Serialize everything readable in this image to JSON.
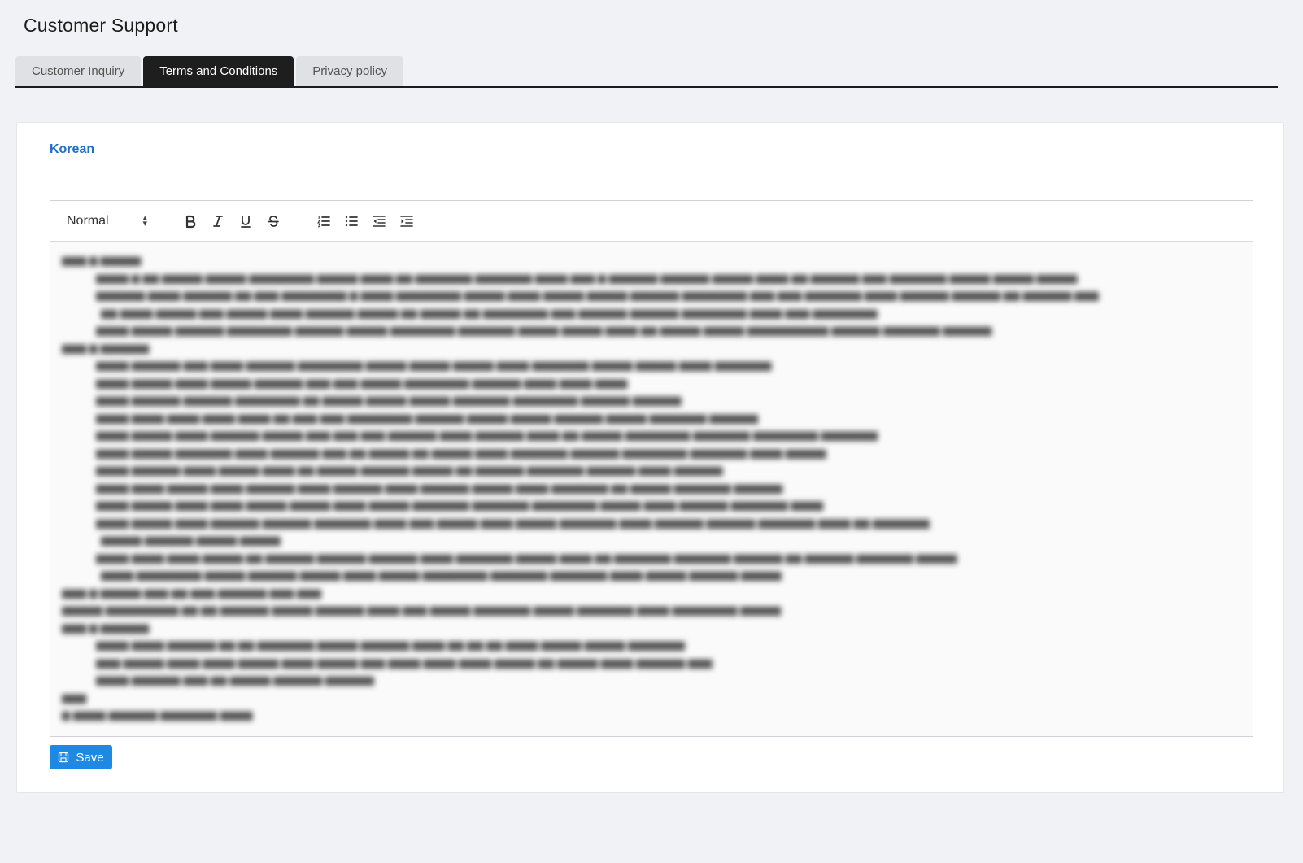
{
  "page": {
    "title": "Customer Support"
  },
  "tabs": [
    {
      "label": "Customer Inquiry",
      "active": false
    },
    {
      "label": "Terms and Conditions",
      "active": true
    },
    {
      "label": "Privacy policy",
      "active": false
    }
  ],
  "card": {
    "language_label": "Korean"
  },
  "editor": {
    "format_value": "Normal",
    "toolbar_icons": [
      "bold-icon",
      "italic-icon",
      "underline-icon",
      "strikethrough-icon",
      "ordered-list-icon",
      "bullet-list-icon",
      "outdent-icon",
      "indent-icon"
    ]
  },
  "actions": {
    "save_label": "Save"
  },
  "colors": {
    "accent": "#1e88e5",
    "link": "#1f6fc6",
    "active_tab": "#1e1e1e"
  }
}
